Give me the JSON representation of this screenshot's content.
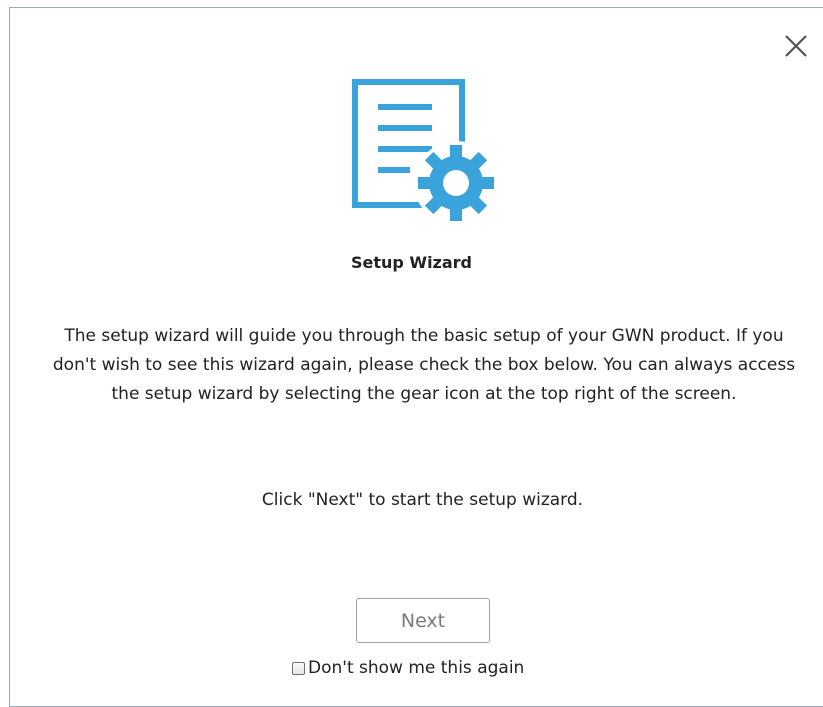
{
  "dialog": {
    "close_icon": "close-icon",
    "header_icon": "document-gear-icon",
    "accent_color": "#3aa3dc",
    "title": "Setup Wizard",
    "description": "The setup wizard will guide you through the basic setup of your GWN product. If you don't wish to see this wizard again, please check the box below. You can always access the setup wizard by selecting the gear icon at the top right of the screen.",
    "hint": "Click \"Next\" to start the setup wizard.",
    "next_label": "Next",
    "dont_show_label": "Don't show me this again",
    "dont_show_checked": false
  }
}
